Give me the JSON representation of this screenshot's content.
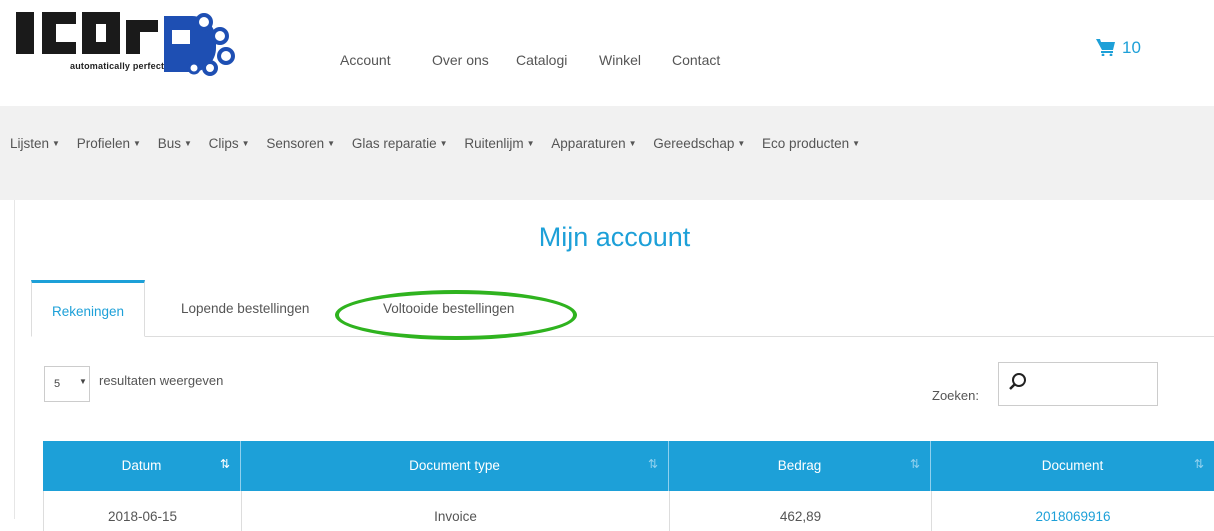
{
  "brand": {
    "logo_text": "ICOR",
    "tagline": "automatically perfect"
  },
  "topnav": {
    "items": [
      "Account",
      "Over ons",
      "Catalogi",
      "Winkel",
      "Contact"
    ]
  },
  "cart": {
    "count": "10",
    "icon": "cart-icon"
  },
  "categories": [
    "Lijsten",
    "Profielen",
    "Bus",
    "Clips",
    "Sensoren",
    "Glas reparatie",
    "Ruitenlijm",
    "Apparaturen",
    "Gereedschap",
    "Eco producten"
  ],
  "page": {
    "title": "Mijn account"
  },
  "tabs": [
    {
      "label": "Rekeningen",
      "active": true
    },
    {
      "label": "Lopende bestellingen",
      "active": false
    },
    {
      "label": "Voltooide bestellingen",
      "active": false,
      "highlighted": true
    }
  ],
  "highlight_color": "#2fb31f",
  "accent_color": "#1da0d8",
  "table_controls": {
    "page_length": "5",
    "page_length_label": "resultaten weergeven",
    "search_label": "Zoeken:",
    "search_value": ""
  },
  "table": {
    "columns": [
      {
        "label": "Datum",
        "sorted": true
      },
      {
        "label": "Document type",
        "sorted": false
      },
      {
        "label": "Bedrag",
        "sorted": false
      },
      {
        "label": "Document",
        "sorted": false
      }
    ],
    "rows": [
      {
        "datum": "2018-06-15",
        "type": "Invoice",
        "bedrag": "462,89",
        "document": "2018069916"
      }
    ]
  }
}
